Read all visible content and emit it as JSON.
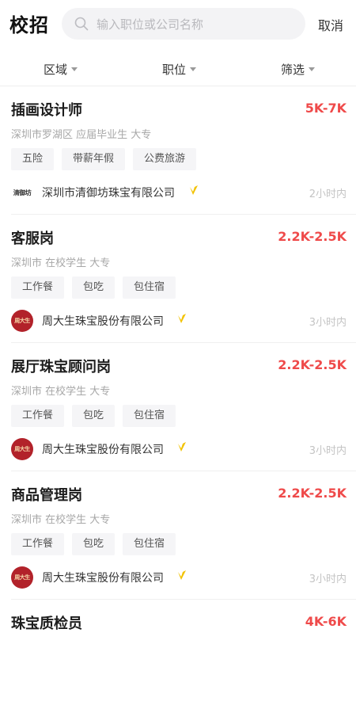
{
  "header": {
    "title": "校招",
    "search_placeholder": "输入职位或公司名称",
    "cancel_label": "取消"
  },
  "filters": [
    {
      "label": "区域"
    },
    {
      "label": "职位"
    },
    {
      "label": "筛选"
    }
  ],
  "jobs": [
    {
      "title": "插画设计师",
      "salary": "5K-7K",
      "meta": "深圳市罗湖区 应届毕业生 大专",
      "tags": [
        "五险",
        "带薪年假",
        "公费旅游"
      ],
      "company": "深圳市清御坊珠宝有限公司",
      "logo_text": "清御坊",
      "time": "2小时内"
    },
    {
      "title": "客服岗",
      "salary": "2.2K-2.5K",
      "meta": "深圳市 在校学生 大专",
      "tags": [
        "工作餐",
        "包吃",
        "包住宿"
      ],
      "company": "周大生珠宝股份有限公司",
      "logo_text": "周大生",
      "time": "3小时内"
    },
    {
      "title": "展厅珠宝顾问岗",
      "salary": "2.2K-2.5K",
      "meta": "深圳市 在校学生 大专",
      "tags": [
        "工作餐",
        "包吃",
        "包住宿"
      ],
      "company": "周大生珠宝股份有限公司",
      "logo_text": "周大生",
      "time": "3小时内"
    },
    {
      "title": "商品管理岗",
      "salary": "2.2K-2.5K",
      "meta": "深圳市 在校学生 大专",
      "tags": [
        "工作餐",
        "包吃",
        "包住宿"
      ],
      "company": "周大生珠宝股份有限公司",
      "logo_text": "周大生",
      "time": "3小时内"
    },
    {
      "title": "珠宝质检员",
      "salary": "4K-6K"
    }
  ],
  "colors": {
    "salary": "#ef4a4a",
    "verified": "#f2c200",
    "logo_red": "#b2222a"
  }
}
